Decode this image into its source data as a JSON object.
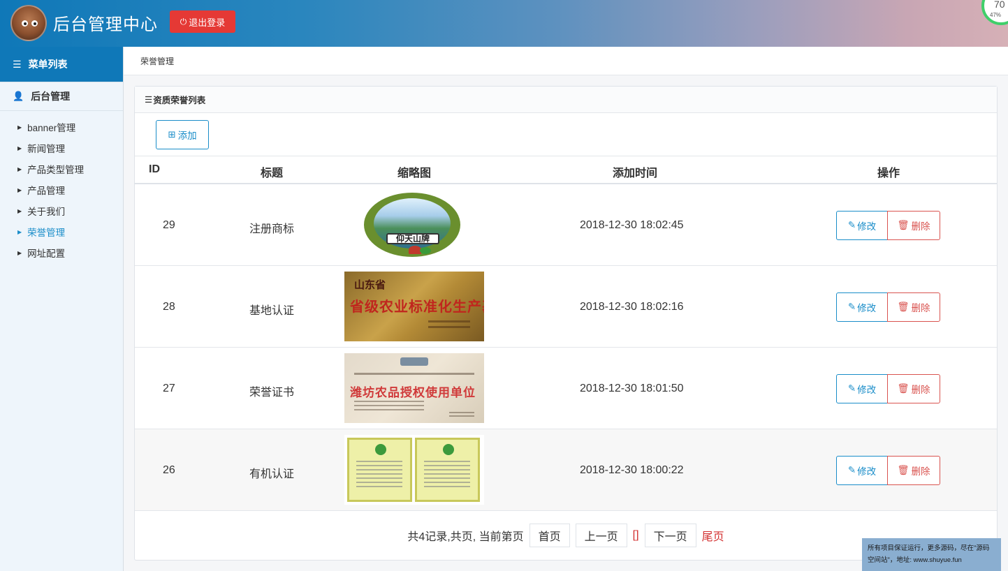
{
  "header": {
    "title": "后台管理中心",
    "logout_label": "退出登录",
    "gauge_value": "70",
    "gauge_percent": "47%"
  },
  "sidebar": {
    "menu_title": "菜单列表",
    "section_title": "后台管理",
    "items": [
      {
        "label": "banner管理",
        "active": false
      },
      {
        "label": "新闻管理",
        "active": false
      },
      {
        "label": "产品类型管理",
        "active": false
      },
      {
        "label": "产品管理",
        "active": false
      },
      {
        "label": "关于我们",
        "active": false
      },
      {
        "label": "荣誉管理",
        "active": true
      },
      {
        "label": "网址配置",
        "active": false
      }
    ]
  },
  "breadcrumb": "荣誉管理",
  "panel": {
    "heading": "资质荣誉列表",
    "add_label": "添加"
  },
  "table": {
    "columns": [
      "ID",
      "标题",
      "缩略图",
      "添加时间",
      "操作"
    ],
    "rows": [
      {
        "id": "29",
        "title": "注册商标",
        "thumb_text": "仰天山牌",
        "time": "2018-12-30 18:02:45",
        "edit": "修改",
        "delete": "删除"
      },
      {
        "id": "28",
        "title": "基地认证",
        "thumb_text": "山东省",
        "thumb_text2": "省级农业标准化生产基地",
        "time": "2018-12-30 18:02:16",
        "edit": "修改",
        "delete": "删除"
      },
      {
        "id": "27",
        "title": "荣誉证书",
        "thumb_text": "潍坊农品授权使用单位",
        "time": "2018-12-30 18:01:50",
        "edit": "修改",
        "delete": "删除"
      },
      {
        "id": "26",
        "title": "有机认证",
        "time": "2018-12-30 18:00:22",
        "edit": "修改",
        "delete": "删除"
      }
    ]
  },
  "pagination": {
    "summary": "共4记录,共页, 当前第页",
    "first": "首页",
    "prev": "上一页",
    "current": "[]",
    "next": "下一页",
    "last": "尾页"
  },
  "watermark": {
    "line1": "所有项目保证运行，更多源码，尽在\"源码",
    "line2": "空间站\"，地址: www.shuyue.fun"
  },
  "colors": {
    "primary": "#1a8dc9",
    "danger": "#e53935",
    "header_start": "#0f78b8"
  }
}
